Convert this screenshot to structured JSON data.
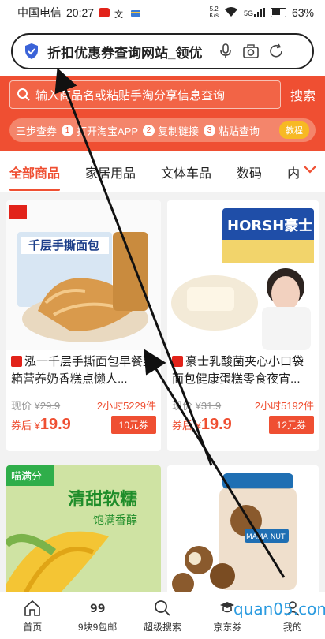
{
  "status_bar": {
    "carrier": "中国电信",
    "time": "20:27",
    "net_speed_top": "5.2",
    "net_speed_bottom": "K/s",
    "signal": "5G",
    "battery": "63%"
  },
  "browser": {
    "url_title": "折扣优惠券查询网站_领优"
  },
  "search": {
    "placeholder": "输入商品名或粘贴手淘分享信息查询",
    "button": "搜索"
  },
  "steps": {
    "label": "三步查券",
    "step1": "打开淘宝APP",
    "step2": "复制链接",
    "step3": "粘贴查询",
    "n1": "1",
    "n2": "2",
    "n3": "3",
    "tutorial": "教程"
  },
  "tabs": [
    {
      "label": "全部商品",
      "active": true
    },
    {
      "label": "家居用品"
    },
    {
      "label": "文体车品"
    },
    {
      "label": "数码"
    },
    {
      "label": "内"
    }
  ],
  "products": [
    {
      "title": "泓一千层手撕面包早餐整箱营养奶香糕点懒人...",
      "orig_label": "现价 ¥",
      "orig_price": "29.9",
      "sold": "2小时5229件",
      "after_label": "券后 ¥",
      "after_price": "19.9",
      "coupon": "10元券",
      "image_text": "千层手撕面包"
    },
    {
      "title": "豪士乳酸菌夹心小口袋面包健康蛋糕零食夜宵...",
      "orig_label": "现价 ¥",
      "orig_price": "31.9",
      "sold": "2小时5192件",
      "after_label": "券后 ¥",
      "after_price": "19.9",
      "coupon": "12元券",
      "image_text": "HORSH豪士"
    },
    {
      "image_text": "清甜软糯",
      "image_sub": "饱满香醇",
      "image_badge": "喵满分"
    },
    {
      "image_text": "MAMA NUT"
    }
  ],
  "bottom_nav": [
    {
      "label": "首页",
      "icon": "home-icon"
    },
    {
      "label": "9块9包邮",
      "icon": "nine-icon"
    },
    {
      "label": "超级搜索",
      "icon": "search-icon"
    },
    {
      "label": "京东券",
      "icon": "jd-icon"
    },
    {
      "label": "我的",
      "icon": "user-icon"
    }
  ],
  "watermark": "quan05.com",
  "colors": {
    "brand_red": "#ef4f32",
    "coupon_red": "#ef4f32",
    "tutorial_yellow": "#f7b924"
  }
}
